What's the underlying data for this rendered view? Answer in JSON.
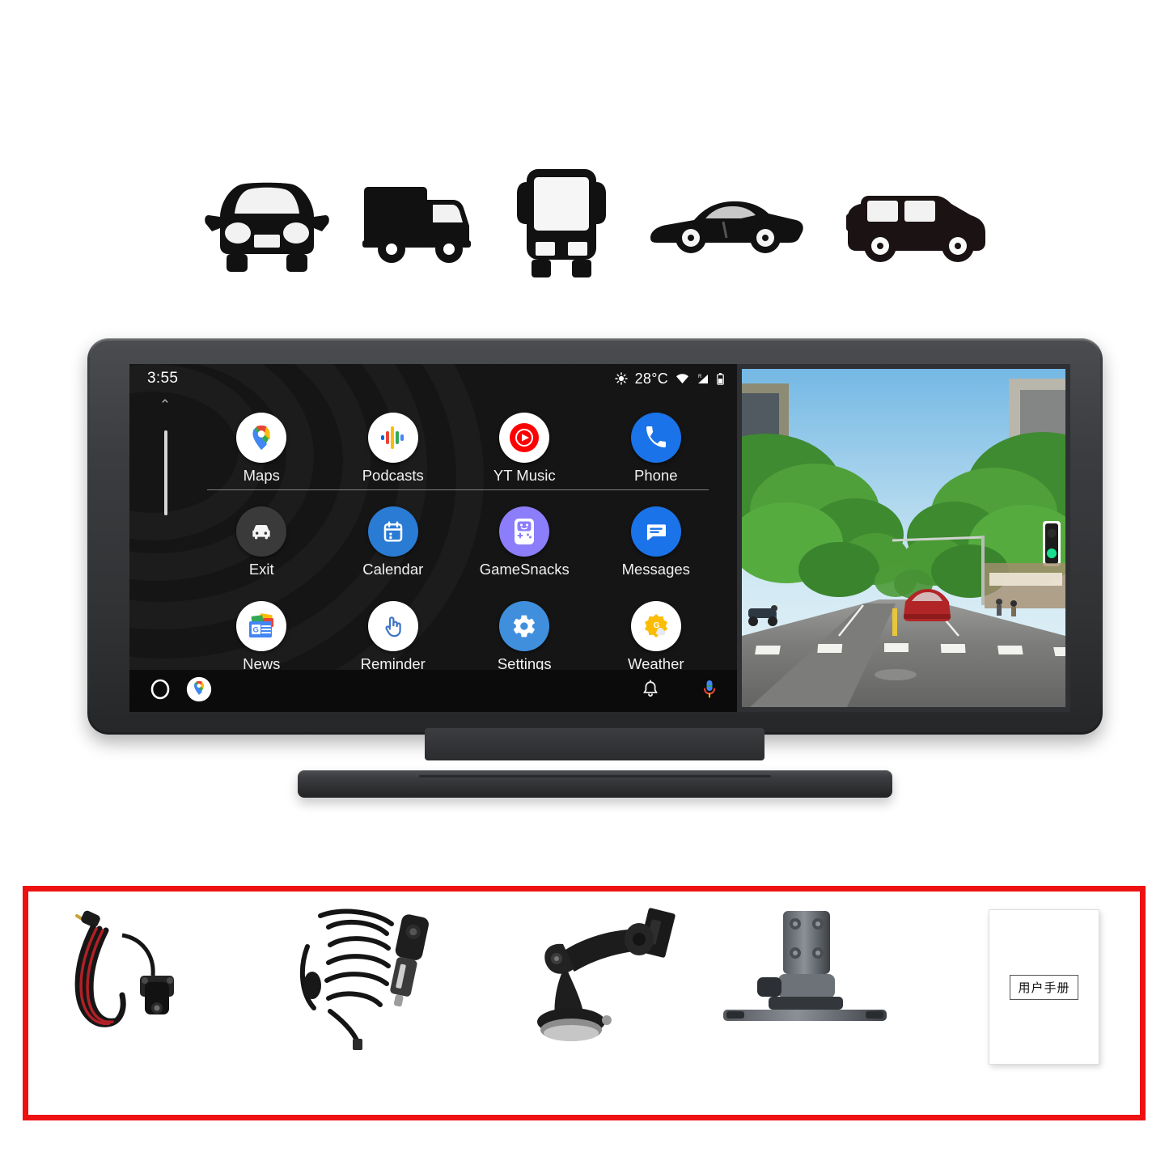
{
  "product": {
    "type": "car-dashboard-display",
    "vehicles": [
      {
        "name": "sedan-front",
        "label": "Sedan"
      },
      {
        "name": "truck-side",
        "label": "Truck"
      },
      {
        "name": "bus-front",
        "label": "Bus"
      },
      {
        "name": "sports-car-side",
        "label": "Sports Car"
      },
      {
        "name": "suv-side",
        "label": "SUV"
      }
    ]
  },
  "screen": {
    "status_bar": {
      "time": "3:55",
      "weather_icon": "sun-icon",
      "temperature": "28°C",
      "wifi_icon": "wifi-icon",
      "signal_icon": "signal-roaming-icon",
      "signal_roaming_label": "R",
      "battery_icon": "battery-icon"
    },
    "scroll": {
      "up_chevron": "⌃",
      "down_chevron": "⌄"
    },
    "apps": [
      {
        "label": "Maps",
        "icon": "google-maps-icon",
        "bg": "#ffffff"
      },
      {
        "label": "Podcasts",
        "icon": "google-podcasts-icon",
        "bg": "#ffffff"
      },
      {
        "label": "YT Music",
        "icon": "youtube-music-icon",
        "bg": "#ffffff"
      },
      {
        "label": "Phone",
        "icon": "phone-icon",
        "bg": "#1a73e8"
      },
      {
        "label": "Exit",
        "icon": "exit-car-icon",
        "bg": "#3a3a3a"
      },
      {
        "label": "Calendar",
        "icon": "calendar-icon",
        "bg": "#2a7bd4"
      },
      {
        "label": "GameSnacks",
        "icon": "gamesnacks-icon",
        "bg": "#8c7dfb"
      },
      {
        "label": "Messages",
        "icon": "messages-icon",
        "bg": "#1a73e8"
      },
      {
        "label": "News",
        "icon": "google-news-icon",
        "bg": "#ffffff"
      },
      {
        "label": "Reminder",
        "icon": "reminder-hand-icon",
        "bg": "#ffffff"
      },
      {
        "label": "Settings",
        "icon": "settings-gear-icon",
        "bg": "#3f8fdd"
      },
      {
        "label": "Weather",
        "icon": "weather-sun-icon",
        "bg": "#ffffff"
      }
    ],
    "nav_bar": {
      "home_icon": "home-circle-icon",
      "maps_icon": "google-maps-icon",
      "notifications_icon": "bell-icon",
      "assistant_icon": "microphone-icon"
    },
    "camera_view": {
      "description": "dashcam-street-view",
      "traffic_light": "green"
    }
  },
  "accessories": {
    "border_color": "#ee1111",
    "items": [
      {
        "name": "rear-camera-with-cable"
      },
      {
        "name": "car-charger-cable"
      },
      {
        "name": "suction-cup-mount"
      },
      {
        "name": "dashboard-bracket-mount"
      },
      {
        "name": "user-manual",
        "label": "用户手册"
      }
    ]
  }
}
